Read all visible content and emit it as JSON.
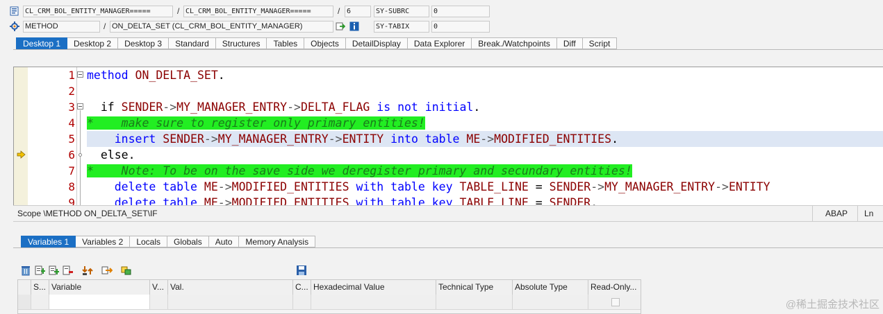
{
  "header": {
    "program_field": "CL_CRM_BOL_ENTITY_MANAGER=====",
    "include_field": "CL_CRM_BOL_ENTITY_MANAGER=====",
    "line_field": "6",
    "sy_subrc_label": "SY-SUBRC",
    "sy_subrc_value": "0",
    "event_type": "METHOD",
    "event_name": "ON_DELTA_SET (CL_CRM_BOL_ENTITY_MANAGER)",
    "sy_tabix_label": "SY-TABIX",
    "sy_tabix_value": "0",
    "separator": "/"
  },
  "desktop_tabs": [
    {
      "label": "Desktop 1",
      "active": true
    },
    {
      "label": "Desktop 2"
    },
    {
      "label": "Desktop 3"
    },
    {
      "label": "Standard"
    },
    {
      "label": "Structures"
    },
    {
      "label": "Tables"
    },
    {
      "label": "Objects"
    },
    {
      "label": "DetailDisplay"
    },
    {
      "label": "Data Explorer"
    },
    {
      "label": "Break./Watchpoints"
    },
    {
      "label": "Diff"
    },
    {
      "label": "Script"
    }
  ],
  "editor": {
    "line_numbers": [
      "1",
      "2",
      "3",
      "4",
      "5",
      "6",
      "7",
      "8",
      "9"
    ],
    "current_line": "6",
    "lines": [
      [
        {
          "t": "method ",
          "c": "kw"
        },
        {
          "t": "ON_DELTA_SET",
          "c": "id"
        },
        {
          "t": ".",
          "c": "pl"
        }
      ],
      [],
      [
        {
          "t": "  if ",
          "c": "pl"
        },
        {
          "t": "SENDER",
          "c": "id"
        },
        {
          "t": "->",
          "c": "op"
        },
        {
          "t": "MY_MANAGER_ENTRY",
          "c": "id"
        },
        {
          "t": "->",
          "c": "op"
        },
        {
          "t": "DELTA_FLAG",
          "c": "id"
        },
        {
          "t": " is not initial",
          "c": "kw"
        },
        {
          "t": ".",
          "c": "pl"
        }
      ],
      [
        {
          "t": "*    make sure to register only primary entities!",
          "c": "cmt"
        }
      ],
      [
        {
          "t": "    insert ",
          "c": "kw"
        },
        {
          "t": "SENDER",
          "c": "id"
        },
        {
          "t": "->",
          "c": "op"
        },
        {
          "t": "MY_MANAGER_ENTRY",
          "c": "id"
        },
        {
          "t": "->",
          "c": "op"
        },
        {
          "t": "ENTITY",
          "c": "id"
        },
        {
          "t": " into table ",
          "c": "kw"
        },
        {
          "t": "ME",
          "c": "id"
        },
        {
          "t": "->",
          "c": "op"
        },
        {
          "t": "MODIFIED_ENTITIES",
          "c": "id"
        },
        {
          "t": ".",
          "c": "pl"
        }
      ],
      [
        {
          "t": "  else.",
          "c": "pl"
        }
      ],
      [
        {
          "t": "*    Note: To be on the save side we deregister primary and secundary entities!",
          "c": "cmt"
        }
      ],
      [
        {
          "t": "    delete table ",
          "c": "kw"
        },
        {
          "t": "ME",
          "c": "id"
        },
        {
          "t": "->",
          "c": "op"
        },
        {
          "t": "MODIFIED_ENTITIES",
          "c": "id"
        },
        {
          "t": " with table key ",
          "c": "kw"
        },
        {
          "t": "TABLE_LINE",
          "c": "id"
        },
        {
          "t": " = ",
          "c": "pl"
        },
        {
          "t": "SENDER",
          "c": "id"
        },
        {
          "t": "->",
          "c": "op"
        },
        {
          "t": "MY_MANAGER_ENTRY",
          "c": "id"
        },
        {
          "t": "->",
          "c": "op"
        },
        {
          "t": "ENTITY",
          "c": "id"
        }
      ],
      [
        {
          "t": "    delete table ",
          "c": "kw"
        },
        {
          "t": "ME",
          "c": "id"
        },
        {
          "t": "->",
          "c": "op"
        },
        {
          "t": "MODIFIED_ENTITIES",
          "c": "id"
        },
        {
          "t": " with table key ",
          "c": "kw"
        },
        {
          "t": "TABLE_LINE",
          "c": "id"
        },
        {
          "t": " = ",
          "c": "pl"
        },
        {
          "t": "SENDER",
          "c": "id"
        },
        {
          "t": ".",
          "c": "pl"
        }
      ]
    ]
  },
  "status_bar": {
    "scope": "Scope \\METHOD ON_DELTA_SET\\IF",
    "language": "ABAP",
    "position": "Ln"
  },
  "variable_tabs": [
    {
      "label": "Variables 1",
      "active": true
    },
    {
      "label": "Variables 2"
    },
    {
      "label": "Locals"
    },
    {
      "label": "Globals"
    },
    {
      "label": "Auto"
    },
    {
      "label": "Memory Analysis"
    }
  ],
  "grid": {
    "columns": [
      "S...",
      "Variable",
      "V...",
      "Val.",
      "C...",
      "Hexadecimal Value",
      "Technical Type",
      "Absolute Type",
      "Read-Only..."
    ]
  },
  "watermark": "@稀土掘金技术社区"
}
